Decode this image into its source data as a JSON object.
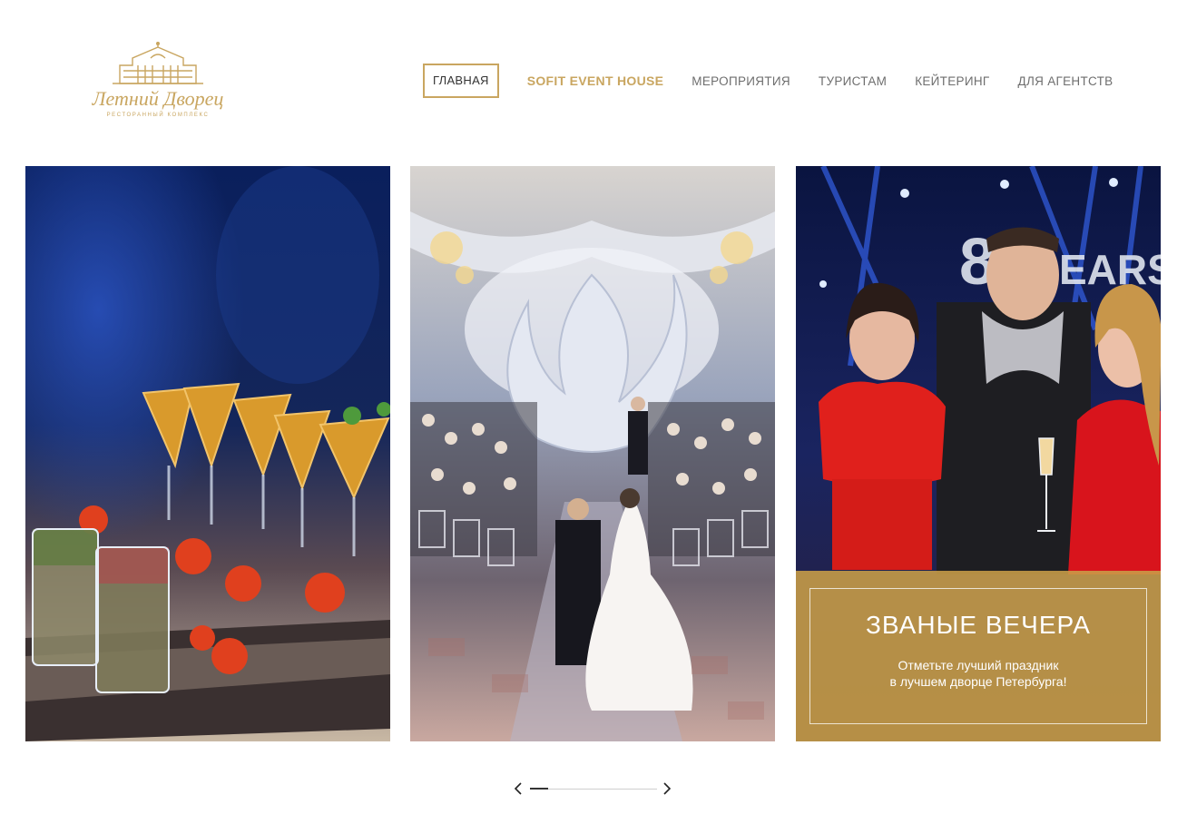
{
  "logo": {
    "title": "Летний Дворец",
    "subtitle": "РЕСТОРАННЫЙ КОМПЛЕКС",
    "icon": "palace-icon",
    "color": "#c9a660"
  },
  "nav": {
    "items": [
      {
        "label": "ГЛАВНАЯ",
        "state": "active"
      },
      {
        "label": "SOFIT EVENT HOUSE",
        "state": "accent"
      },
      {
        "label": "МЕРОПРИЯТИЯ",
        "state": "normal"
      },
      {
        "label": "ТУРИСТАМ",
        "state": "normal"
      },
      {
        "label": "КЕЙТЕРИНГ",
        "state": "normal"
      },
      {
        "label": "ДЛЯ АГЕНТСТВ",
        "state": "normal"
      }
    ]
  },
  "slides": [
    {
      "image": "catering-appetizers-photo"
    },
    {
      "image": "wedding-ceremony-photo"
    },
    {
      "image": "party-guests-photo",
      "caption": {
        "title": "ЗВАНЫЕ ВЕЧЕРА",
        "line1": "Отметьте лучший праздник",
        "line2": "в лучшем дворце Петербурга!"
      }
    }
  ],
  "slider": {
    "prev_icon": "chevron-left-icon",
    "next_icon": "chevron-right-icon",
    "progress": 0.14
  },
  "colors": {
    "accent": "#c9a660",
    "caption_bg": "#c99e48",
    "nav_text": "#6e6e6e"
  }
}
